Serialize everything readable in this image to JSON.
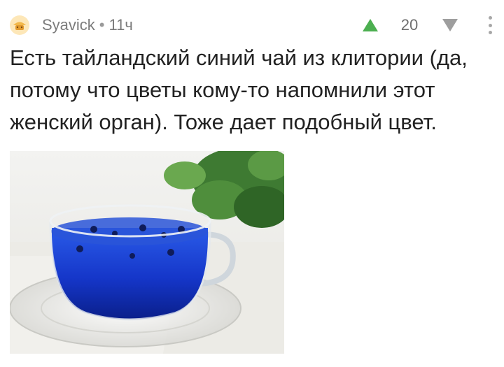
{
  "comment": {
    "author": "Syavick",
    "separator": "•",
    "time": "11ч",
    "rating": "20",
    "text": "Есть тайландский синий чай из клитории (да, потому что цветы кому-то напомнили этот женский орган). Тоже дает подобный цвет."
  },
  "icons": {
    "avatar": "avatar-icon",
    "upvote": "arrow-up-icon",
    "downvote": "arrow-down-icon",
    "menu": "more-vertical-icon"
  },
  "colors": {
    "upvote": "#4caf50",
    "downvote": "#9e9e9e",
    "meta_text": "#7b7b7b",
    "body_text": "#222222",
    "tea": "#1a3fd6"
  }
}
